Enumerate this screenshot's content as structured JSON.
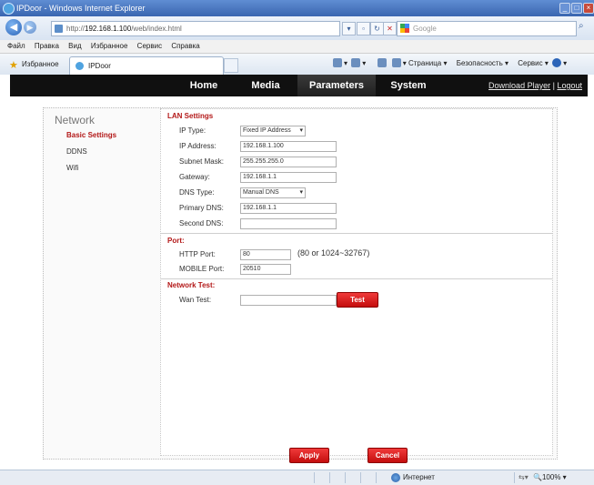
{
  "window": {
    "title": "IPDoor - Windows Internet Explorer"
  },
  "address_bar": {
    "url_prefix": "http://",
    "url_host": "192.168.1.100",
    "url_path": "/web/index.html",
    "search_placeholder": "Google"
  },
  "menu": [
    "Файл",
    "Правка",
    "Вид",
    "Избранное",
    "Сервис",
    "Справка"
  ],
  "favorites": {
    "label": "Избранное",
    "tab_title": "IPDoor"
  },
  "command_bar": [
    "Страница",
    "Безопасность",
    "Сервис"
  ],
  "site_nav": {
    "tabs": [
      "Home",
      "Media",
      "Parameters",
      "System"
    ],
    "active_tab": "Parameters",
    "download_player": "Download Player",
    "separator": "|",
    "logout": "Logout"
  },
  "subnav": {
    "title": "Network",
    "items": [
      "Basic Settings",
      "DDNS",
      "Wifi"
    ],
    "active": "Basic Settings"
  },
  "lan": {
    "title": "LAN Settings",
    "ip_type_label": "IP Type:",
    "ip_type_value": "Fixed IP Address",
    "ip_address_label": "IP Address:",
    "ip_address_value": "192.168.1.100",
    "subnet_mask_label": "Subnet Mask:",
    "subnet_mask_value": "255.255.255.0",
    "gateway_label": "Gateway:",
    "gateway_value": "192.168.1.1",
    "dns_type_label": "DNS Type:",
    "dns_type_value": "Manual DNS",
    "primary_dns_label": "Primary DNS:",
    "primary_dns_value": "192.168.1.1",
    "second_dns_label": "Second DNS:",
    "second_dns_value": ""
  },
  "port": {
    "title": "Port:",
    "http_port_label": "HTTP Port:",
    "http_port_value": "80",
    "http_port_hint": "(80 or 1024~32767)",
    "mobile_port_label": "MOBILE Port:",
    "mobile_port_value": "20510"
  },
  "network_test": {
    "title": "Network Test:",
    "wan_test_label": "Wan Test:",
    "wan_test_value": "",
    "test_button": "Test"
  },
  "actions": {
    "apply": "Apply",
    "cancel": "Cancel"
  },
  "status_bar": {
    "zone": "Интернет",
    "zoom": "100%"
  }
}
